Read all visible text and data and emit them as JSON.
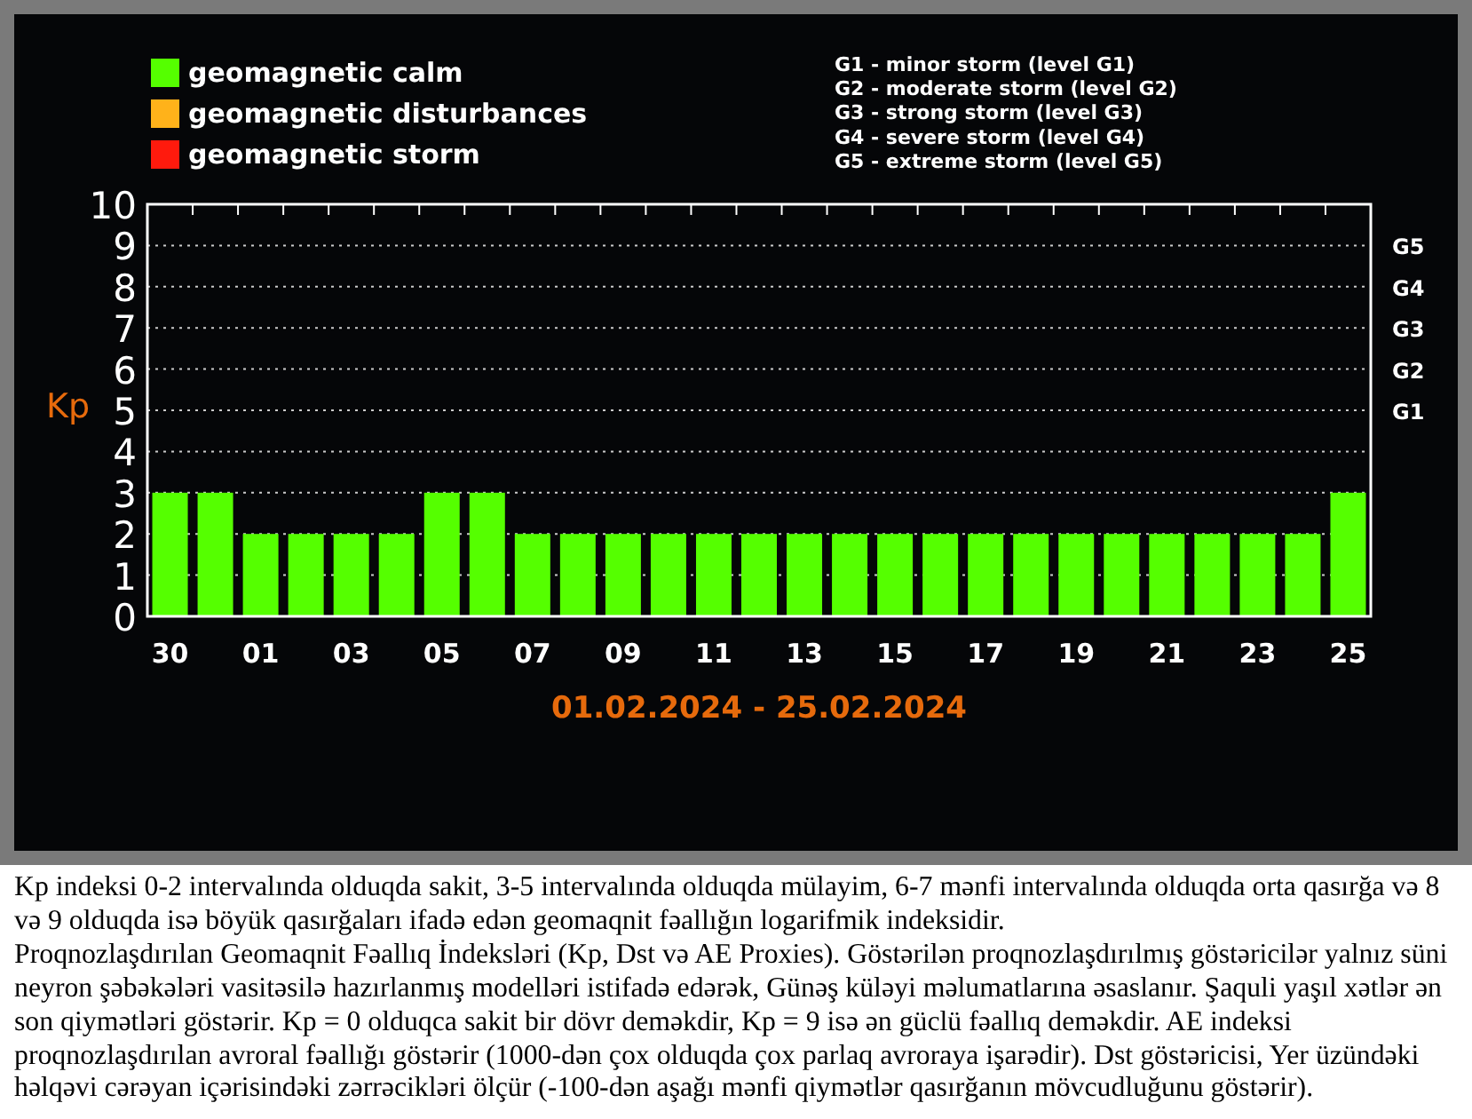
{
  "legend": [
    {
      "label": "geomagnetic calm",
      "color": "#55ff00"
    },
    {
      "label": "geomagnetic disturbances",
      "color": "#ffb21a"
    },
    {
      "label": "geomagnetic storm",
      "color": "#ff1a0d"
    }
  ],
  "storm_scale": [
    "G1 - minor storm (level G1)",
    "G2 - moderate storm (level G2)",
    "G3 - strong storm (level G3)",
    "G4 - severe storm (level G4)",
    "G5 - extreme storm (level G5)"
  ],
  "chart_data": {
    "type": "bar",
    "title": "01.02.2024 - 25.02.2024",
    "ylabel": "Kp",
    "categories": [
      "30",
      null,
      "01",
      null,
      "03",
      null,
      "05",
      null,
      "07",
      null,
      "09",
      null,
      "11",
      null,
      "13",
      null,
      "15",
      null,
      "17",
      null,
      "19",
      null,
      "21",
      null,
      "23",
      null,
      "25"
    ],
    "series": [
      {
        "color": "#55ff00",
        "values": [
          3,
          3,
          2,
          2,
          2,
          2,
          3,
          3,
          2,
          2,
          2,
          2,
          2,
          2,
          2,
          2,
          2,
          2,
          2,
          2,
          2,
          2,
          2,
          2,
          2,
          2,
          3
        ]
      }
    ],
    "ylim": [
      0,
      10
    ],
    "yticks": [
      0,
      1,
      2,
      3,
      4,
      5,
      6,
      7,
      8,
      9,
      10
    ],
    "grid": true,
    "annotations": [
      "G1",
      "G2",
      "G3",
      "G4",
      "G5"
    ]
  },
  "paragraphs": [
    "Kp indeksi 0-2 intervalında olduqda sakit, 3-5 intervalında olduqda mülayim, 6-7 mənfi intervalında olduqda orta qasırğa və 8 və 9 olduqda isə böyük qasırğaları ifadə edən geomaqnit fəallığın logarifmik indeksidir.",
    "Proqnozlaşdırılan Geomaqnit Fəallıq İndeksləri (Kp, Dst və AE Proxies). Göstərilən proqnozlaşdırılmış göstəricilər yalnız süni neyron şəbəkələri vasitəsilə hazırlanmış modelləri istifadə edərək, Günəş küləyi məlumatlarına əsaslanır. Şaquli yaşıl xətlər ən son qiymətləri göstərir. Kp = 0 olduqca sakit bir dövr deməkdir, Kp = 9 isə ən güclü fəallıq deməkdir. AE indeksi proqnozlaşdırılan avroral fəallığı göstərir (1000-dən çox olduqda çox parlaq avroraya işarədir). Dst göstəricisi, Yer üzündəki həlqəvi cərəyan içərisindəki zərrəcikləri ölçür (-100-dən aşağı mənfi qiymətlər qasırğanın mövcudluğunu göstərir)."
  ]
}
